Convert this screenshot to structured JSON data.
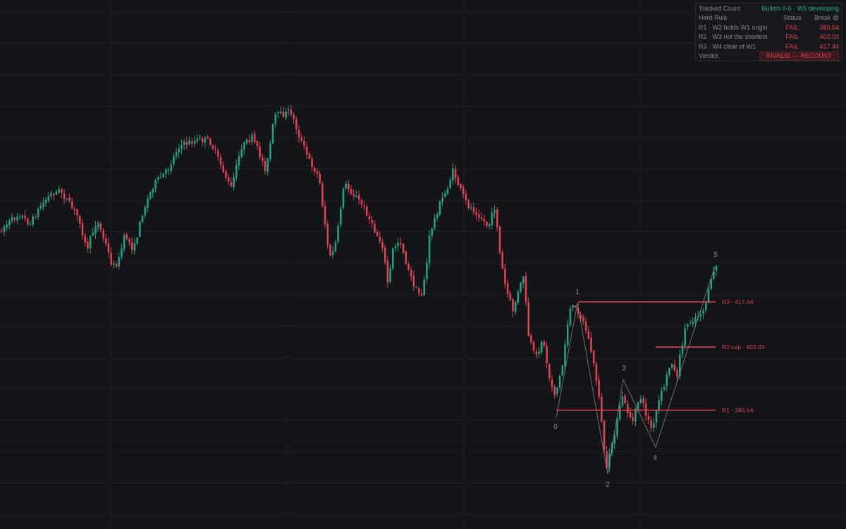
{
  "chart_data": {
    "type": "candlestick",
    "colors": {
      "background": "#141518",
      "up": "#26a085",
      "down": "#e0434f",
      "level": "#e0434f",
      "grid": "#1d1f24",
      "wave_line": "#8a8d93",
      "wave_label": "#8a8d93"
    },
    "grid": true,
    "y_range": [
      350,
      470
    ],
    "wave_labels": [
      {
        "label": "0",
        "price": 380.54
      },
      {
        "label": "1",
        "price": 417.44
      },
      {
        "label": "2",
        "price": 359
      },
      {
        "label": "3",
        "price": 393
      },
      {
        "label": "4",
        "price": 371
      },
      {
        "label": "5",
        "price": 430
      }
    ],
    "levels": [
      {
        "name": "R3",
        "label": "R3 · 417.44",
        "price": 417.44
      },
      {
        "name": "R2",
        "label": "R2 cap · 402.03",
        "price": 402.03
      },
      {
        "name": "R1",
        "label": "R1 · 380.54",
        "price": 380.54
      }
    ]
  },
  "rules_table": {
    "title": "Tracked Count",
    "count_status": "Bullish 0-5 · W5 developing",
    "headers": {
      "rule": "Hard Rule",
      "status": "Status",
      "break": "Break @"
    },
    "rows": [
      {
        "rule": "R1 · W2 holds W1 origin",
        "status": "FAIL",
        "break": "380.54"
      },
      {
        "rule": "R2 · W3 not the shortest",
        "status": "FAIL",
        "break": "402.03"
      },
      {
        "rule": "R3 · W4 clear of W1",
        "status": "FAIL",
        "break": "417.44"
      }
    ],
    "verdict_label": "Verdict",
    "verdict_value": "INVALID — RECOUNT"
  }
}
